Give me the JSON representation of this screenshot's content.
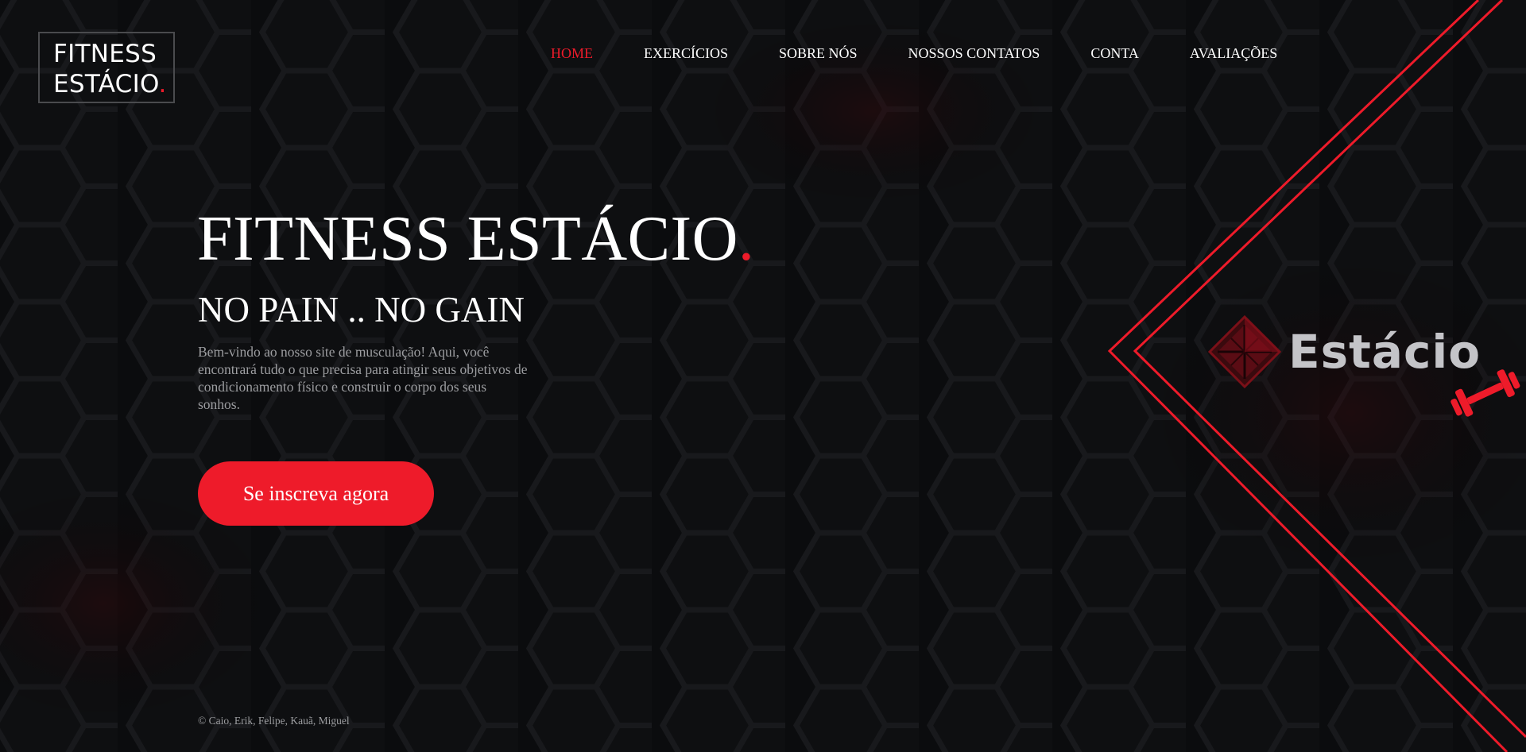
{
  "logo": {
    "line1": "FITNESS",
    "line2": "ESTÁCIO",
    "dot": "."
  },
  "nav": {
    "items": [
      {
        "label": "HOME",
        "active": true
      },
      {
        "label": "EXERCÍCIOS"
      },
      {
        "label": "SOBRE NÓS"
      },
      {
        "label": "NOSSOS CONTATOS"
      },
      {
        "label": "CONTA"
      },
      {
        "label": "AVALIAÇÕES"
      }
    ]
  },
  "hero": {
    "title": "FITNESS ESTÁCIO",
    "title_dot": ".",
    "subtitle": "NO PAIN .. NO GAIN",
    "description": "Bem-vindo ao nosso site de musculação! Aqui, você encontrará tudo o que precisa para atingir seus objetivos de condicionamento físico e construir o corpo dos seus sonhos.",
    "cta_label": "Se inscreva agora"
  },
  "brand": {
    "text": "Estácio"
  },
  "footer": {
    "credits": "© Caio, Erik, Felipe, Kauã, Miguel"
  },
  "colors": {
    "accent": "#ee1b2a",
    "background": "#0b0c0e",
    "hex_line": "#1a1b1e",
    "hex_glow": "#5a0a10",
    "muted_text": "#9c9da0",
    "brand_text": "#c4c4c8"
  },
  "icons": [
    "estacio-diamond-icon",
    "dumbbell-icon"
  ]
}
